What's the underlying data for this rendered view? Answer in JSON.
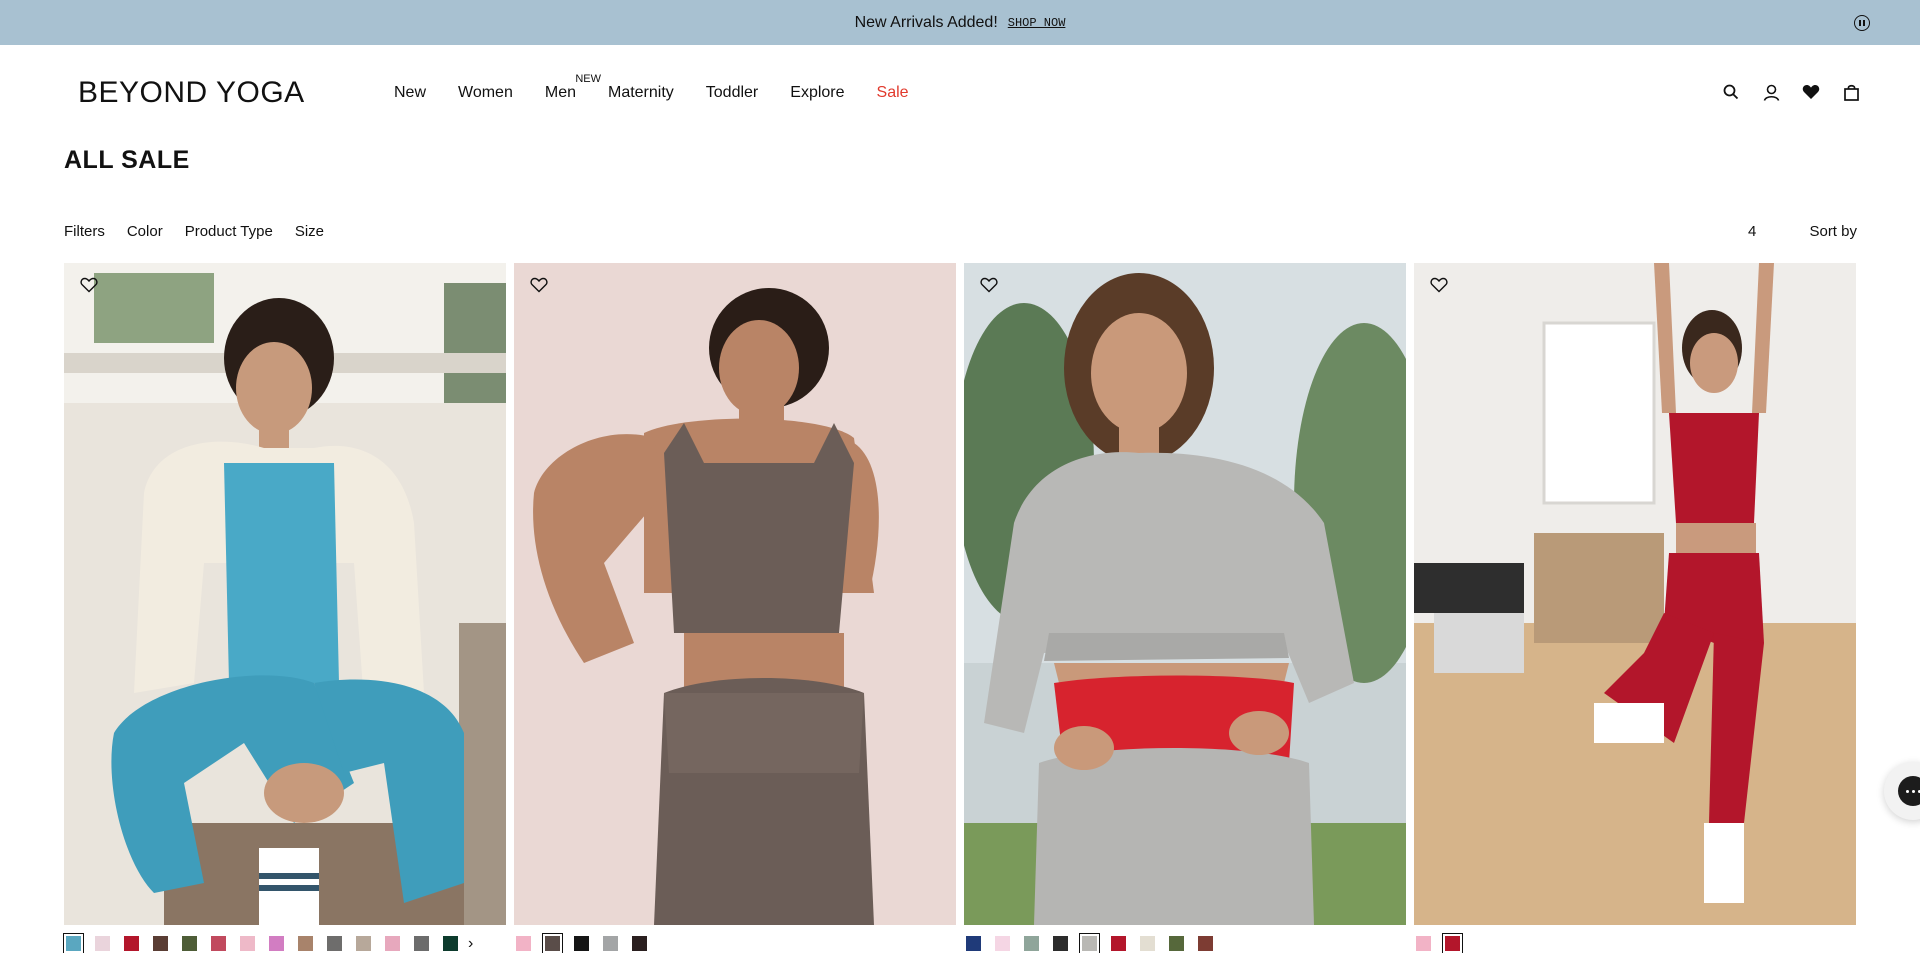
{
  "announcement": {
    "text": "New Arrivals Added!",
    "link": "SHOP NOW",
    "pause_icon": "pause-icon"
  },
  "header": {
    "logo": "BEYOND YOGA",
    "nav": [
      {
        "label": "New"
      },
      {
        "label": "Women"
      },
      {
        "label": "Men",
        "badge": "NEW"
      },
      {
        "label": "Maternity"
      },
      {
        "label": "Toddler"
      },
      {
        "label": "Explore"
      },
      {
        "label": "Sale"
      }
    ],
    "icons": [
      "search-icon",
      "account-icon",
      "wishlist-icon",
      "bag-icon"
    ]
  },
  "page": {
    "title": "ALL SALE"
  },
  "filters": {
    "items": [
      "Filters",
      "Color",
      "Product Type",
      "Size"
    ],
    "count": "4",
    "sort_label": "Sort by"
  },
  "colors": {
    "announcement_bg": "#a8c1d1",
    "sale_red": "#e1392c"
  },
  "products": [
    {
      "image": "woman in teal tank and leggings with cream sweatshirt",
      "swatches": [
        "#5aa7c0",
        "#ead4dc",
        "#b3162b",
        "#5a3d34",
        "#4e5d37",
        "#c14a5e",
        "#eeb9c8",
        "#d27dc2",
        "#a8836b",
        "#6e6d6c",
        "#b7a89a",
        "#e7a8bd",
        "#6c6c6c",
        "#0d3b2d"
      ],
      "selected": 0,
      "has_more": true
    },
    {
      "image": "woman in brown sports bra and leggings",
      "swatches": [
        "#f2b3c6",
        "#5a4d49",
        "#151515",
        "#a3a5a6",
        "#2a1f1f"
      ],
      "selected": 1,
      "has_more": false
    },
    {
      "image": "woman in grey cropped sweatshirt and sweat shorts",
      "swatches": [
        "#1f3a79",
        "#f5d6e4",
        "#8fa59a",
        "#2c2c2c",
        "#b9b8b4",
        "#b3162b",
        "#e3ded2",
        "#56683b",
        "#7d3c33"
      ],
      "selected": 4,
      "has_more": false
    },
    {
      "image": "woman in red crop tank and leggings in studio",
      "swatches": [
        "#f2b3c6",
        "#b3162b"
      ],
      "selected": 1,
      "has_more": false
    }
  ],
  "chat": {
    "icon": "chat-icon"
  }
}
